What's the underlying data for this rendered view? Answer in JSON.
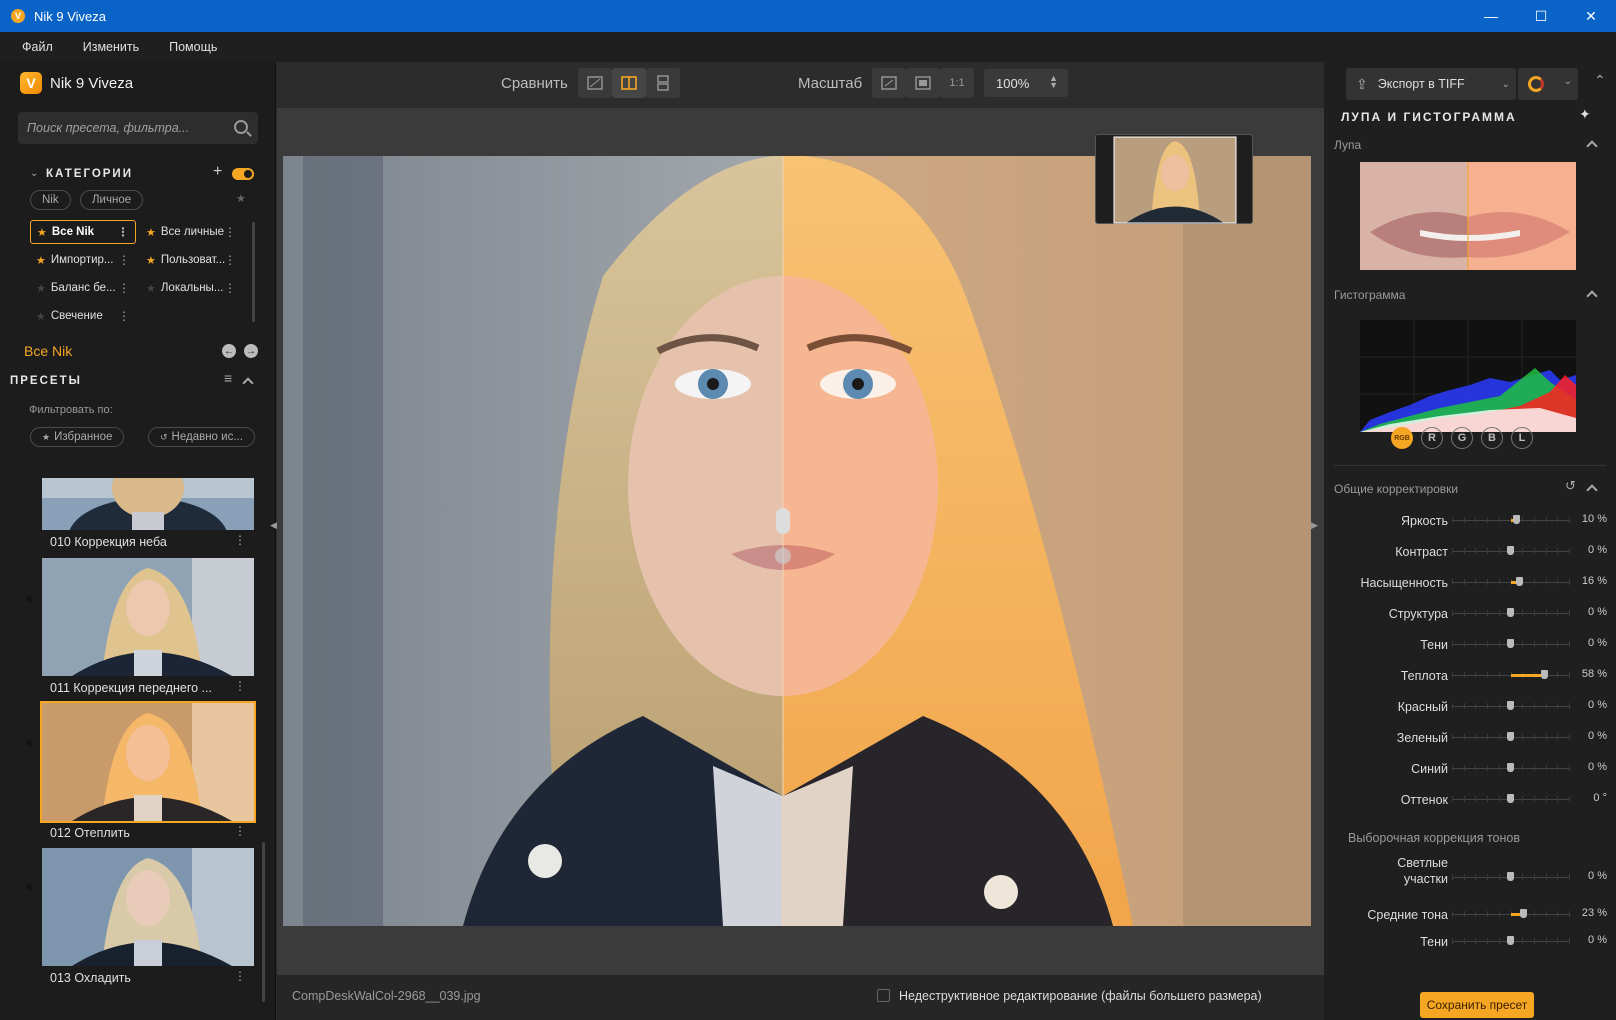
{
  "window": {
    "title": "Nik 9 Viveza",
    "min": "—",
    "max": "☐",
    "close": "✕"
  },
  "menu": [
    "Файл",
    "Изменить",
    "Помощь"
  ],
  "left": {
    "brand": "Nik 9 Viveza",
    "search_placeholder": "Поиск пресета, фильтра...",
    "categories_title": "КАТЕГОРИИ",
    "add": "+",
    "chips": [
      "Nik",
      "Личное"
    ],
    "categories": [
      {
        "label": "Все Nik",
        "active": true
      },
      {
        "label": "Все личные"
      },
      {
        "label": "Импортир..."
      },
      {
        "label": "Пользоват..."
      },
      {
        "label": "Баланс бе..."
      },
      {
        "label": "Локальны..."
      },
      {
        "label": "Свечение"
      }
    ],
    "current_category": "Все Nik",
    "presets_title": "ПРЕСЕТЫ",
    "filter_label": "Фильтровать по:",
    "filter_fav": "Избранное",
    "filter_recent": "Недавно ис...",
    "presets": [
      {
        "label": "010 Коррекция неба"
      },
      {
        "label": "011 Коррекция переднего ..."
      },
      {
        "label": "012 Отеплить"
      },
      {
        "label": "013 Охладить"
      }
    ]
  },
  "toolbar": {
    "compare": "Сравнить",
    "zoom": "Масштаб",
    "one_to_one": "1:1",
    "zoom_value": "100%"
  },
  "status": {
    "filename": "CompDeskWalCol-2968__039.jpg",
    "nondestructive": "Недеструктивное редактирование (файлы большего размера)"
  },
  "right": {
    "export": "Экспорт в TIFF",
    "loupe_title": "ЛУПА И ГИСТОГРАММА",
    "loupe": "Лупа",
    "histogram": "Гистограмма",
    "channels": [
      "RGB",
      "R",
      "G",
      "B",
      "L"
    ],
    "general": "Общие корректировки",
    "sliders": [
      {
        "label": "Яркость",
        "value": "10 %",
        "level": 10
      },
      {
        "label": "Контраст",
        "value": "0 %",
        "level": 0
      },
      {
        "label": "Насыщенность",
        "value": "16 %",
        "level": 16
      },
      {
        "label": "Структура",
        "value": "0 %",
        "level": 0
      },
      {
        "label": "Тени",
        "value": "0 %",
        "level": 0
      },
      {
        "label": "Теплота",
        "value": "58 %",
        "level": 58
      },
      {
        "label": "Красный",
        "value": "0 %",
        "level": 0
      },
      {
        "label": "Зеленый",
        "value": "0 %",
        "level": 0
      },
      {
        "label": "Синий",
        "value": "0 %",
        "level": 0
      },
      {
        "label": "Оттенок",
        "value": "0 °",
        "level": 0
      }
    ],
    "selective": "Выборочная коррекция тонов",
    "selective_sliders": [
      {
        "label": "Светлые участки",
        "value": "0 %",
        "level": 0
      },
      {
        "label": "Средние тона",
        "value": "23 %",
        "level": 23
      },
      {
        "label": "Тени",
        "value": "0 %",
        "level": 0
      }
    ],
    "save_preset": "Сохранить пресет"
  },
  "colors": {
    "accent": "#f5a623",
    "titlebar": "#0a64c8"
  }
}
